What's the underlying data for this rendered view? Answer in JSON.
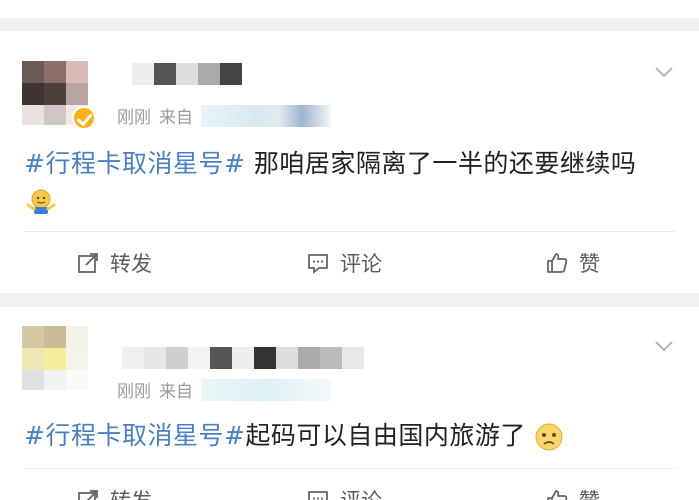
{
  "posts": [
    {
      "time": "刚刚",
      "source_prefix": "来自",
      "topic": "#行程卡取消星号#",
      "body": " 那咱居家隔离了一半的还要继续吗",
      "emoji": "shrug-emoji",
      "actions": {
        "repost": "转发",
        "comment": "评论",
        "like": "赞"
      }
    },
    {
      "time": "刚刚",
      "source_prefix": "来自",
      "topic": "#行程卡取消星号#",
      "body": "起码可以自由国内旅游了",
      "emoji": "worried-face-emoji",
      "actions": {
        "repost": "转发",
        "comment": "评论",
        "like": "赞"
      }
    }
  ],
  "colors": {
    "topic": "#4a7fc0",
    "meta": "#9b9b9b",
    "text": "#222222",
    "verified": "#f7b21b"
  }
}
